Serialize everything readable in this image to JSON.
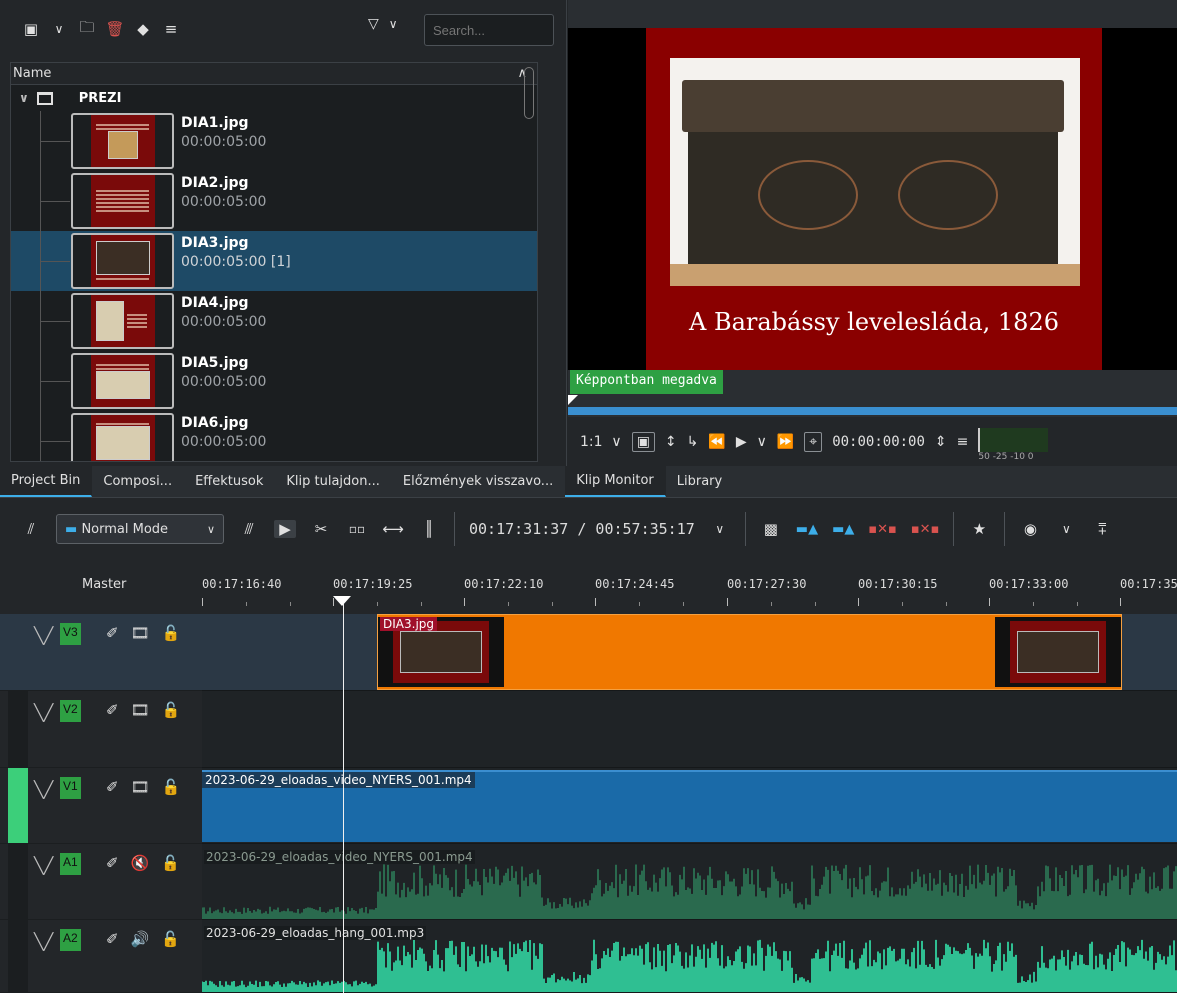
{
  "bin": {
    "search_placeholder": "Search...",
    "column_name": "Name",
    "folder": "PREZI",
    "clips": [
      {
        "name": "DIA1.jpg",
        "duration": "00:00:05:00"
      },
      {
        "name": "DIA2.jpg",
        "duration": "00:00:05:00"
      },
      {
        "name": "DIA3.jpg",
        "duration": "00:00:05:00 [1]"
      },
      {
        "name": "DIA4.jpg",
        "duration": "00:00:05:00"
      },
      {
        "name": "DIA5.jpg",
        "duration": "00:00:05:00"
      },
      {
        "name": "DIA6.jpg",
        "duration": "00:00:05:00"
      }
    ],
    "selected_index": 2
  },
  "monitor": {
    "slide_caption": "A Barabássy levelesláda, 1826",
    "status_tag": "Képpontban megadva",
    "zoom": "1:1",
    "timecode": "00:00:00:00",
    "meter_scale": "50 -25 -10 0"
  },
  "tabs": [
    {
      "label": "Project Bin",
      "active": true
    },
    {
      "label": "Composi...",
      "active": false
    },
    {
      "label": "Effektusok",
      "active": false
    },
    {
      "label": "Klip tulajdon...",
      "active": false
    },
    {
      "label": "Előzmények visszavo...",
      "active": false
    },
    {
      "label": "Klip Monitor",
      "active": true
    },
    {
      "label": "Library",
      "active": false
    }
  ],
  "timeline_toolbar": {
    "mode": "Normal Mode",
    "position": "00:17:31:37 / 00:57:35:17"
  },
  "ruler": {
    "master_label": "Master",
    "ticks": [
      "00:17:16:40",
      "00:17:19:25",
      "00:17:22:10",
      "00:17:24:45",
      "00:17:27:30",
      "00:17:30:15",
      "00:17:33:00",
      "00:17:35"
    ]
  },
  "tracks": [
    {
      "tag": "V3",
      "kind": "video",
      "clip_label": "DIA3.jpg"
    },
    {
      "tag": "V2",
      "kind": "video",
      "clip_label": ""
    },
    {
      "tag": "V1",
      "kind": "video",
      "clip_label": "2023-06-29_eloadas_video_NYERS_001.mp4"
    },
    {
      "tag": "A1",
      "kind": "audio",
      "clip_label": "2023-06-29_eloadas_video_NYERS_001.mp4",
      "muted": true
    },
    {
      "tag": "A2",
      "kind": "audio",
      "clip_label": "2023-06-29_eloadas_hang_001.mp3",
      "muted": false
    }
  ],
  "colors": {
    "accent": "#3daee9",
    "track_tag": "#2ea043",
    "slide_clip": "#f07800",
    "video_clip": "#1a6aa8",
    "audio_wave_a1": "#2a6a4e",
    "audio_wave_a2": "#2fbf92"
  },
  "icons": {
    "bin_toolbar": [
      "add-clip-icon",
      "chevron-down-icon",
      "add-folder-icon",
      "delete-icon",
      "tag-icon",
      "menu-icon",
      "filter-icon"
    ],
    "timeline_toolbar": [
      "settings-sliders-icon",
      "spacer-icon",
      "select-icon",
      "razor-icon",
      "ripple-icon",
      "slip-icon",
      "multicam-icon",
      "favorites-icon",
      "record-icon"
    ]
  }
}
